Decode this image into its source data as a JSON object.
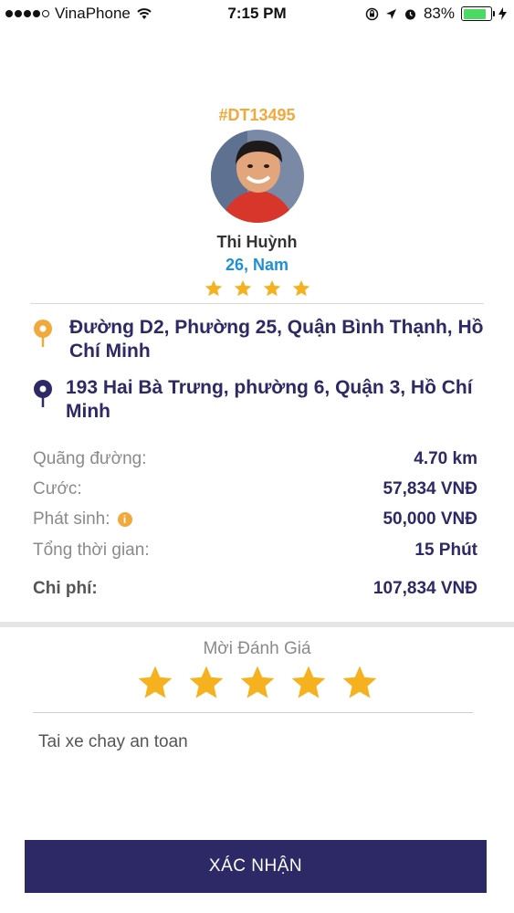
{
  "status_bar": {
    "carrier": "VinaPhone",
    "time": "7:15 PM",
    "battery": "83%",
    "battery_level": 0.83
  },
  "driver": {
    "booking_id": "#DT13495",
    "name": "Thi Huỳnh",
    "age_gender": "26, Nam",
    "rating": 4
  },
  "pickup": {
    "address": "Đường D2, Phường 25, Quận Bình Thạnh, Hồ Chí Minh",
    "icon": "pin-orange-icon",
    "color": "#f2a93b"
  },
  "dropoff": {
    "address": "193 Hai Bà Trưng, phường 6, Quận 3, Hồ Chí Minh",
    "icon": "pin-navy-icon",
    "color": "#2c2966"
  },
  "details": {
    "distance_label": "Quãng đường:",
    "distance_value": "4.70 km",
    "fare_label": "Cước:",
    "fare_value": "57,834 VNĐ",
    "extra_label": "Phát sinh:",
    "extra_value": "50,000 VNĐ",
    "time_label": "Tổng thời gian:",
    "time_value": "15 Phút",
    "total_label": "Chi phí:",
    "total_value": "107,834 VNĐ"
  },
  "rating": {
    "title": "Mời Đánh Giá",
    "stars_selected": 5,
    "comment": "Tai xe chay an toan"
  },
  "confirm_label": "XÁC NHẬN",
  "colors": {
    "accent_orange": "#f2a93b",
    "primary_navy": "#2c2966",
    "meta_blue": "#1f8fd6"
  }
}
